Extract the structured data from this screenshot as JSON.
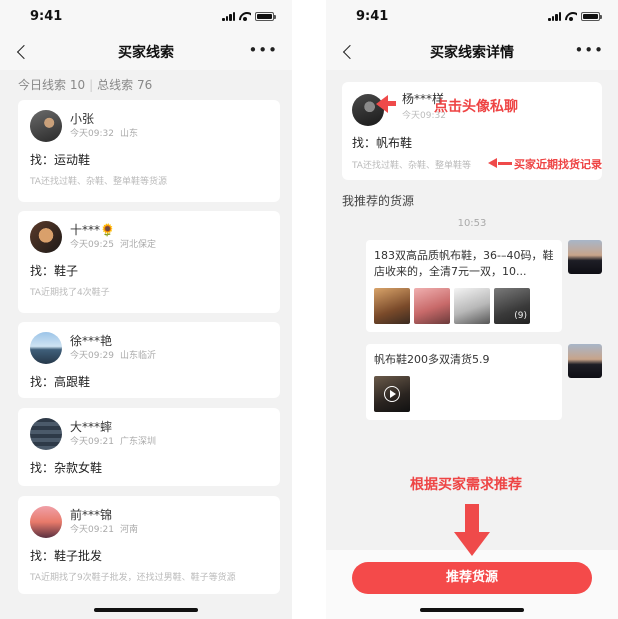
{
  "left_screen": {
    "status_time": "9:41",
    "title": "买家线索",
    "summary_today": "今日线索 10",
    "summary_total": "总线索 76",
    "leads": [
      {
        "name": "小张",
        "time": "今天09:32",
        "location": "山东",
        "want": "找：运动鞋",
        "history": "TA还找过鞋、杂鞋、整单鞋等货源"
      },
      {
        "name": "十***🌻",
        "time": "今天09:25",
        "location": "河北保定",
        "want": "找：鞋子",
        "history": "TA近期找了4次鞋子"
      },
      {
        "name": "徐***艳",
        "time": "今天09:29",
        "location": "山东临沂",
        "want": "找：高跟鞋",
        "history": ""
      },
      {
        "name": "大***蟀",
        "time": "今天09:21",
        "location": "广东深圳",
        "want": "找：杂款女鞋",
        "history": ""
      },
      {
        "name": "前***锦",
        "time": "今天09:21",
        "location": "河南",
        "want": "找：鞋子批发",
        "history": "TA近期找了9次鞋子批发，还找过男鞋、鞋子等货源"
      }
    ]
  },
  "right_screen": {
    "status_time": "9:41",
    "title": "买家线索详情",
    "buyer": {
      "name": "杨***样",
      "sub": "今天09:32",
      "want": "找：帆布鞋",
      "history": "TA还找过鞋、杂鞋、整单鞋等"
    },
    "section_title": "我推荐的货源",
    "timestamp": "10:53",
    "messages": [
      {
        "text": "183双高品质帆布鞋，36-–40码，鞋店收来的，全清7元一双，10...",
        "thumb_count": "(9)"
      },
      {
        "text": "帆布鞋200多双清货5.9"
      }
    ],
    "button_label": "推荐货源"
  },
  "annotations": {
    "avatar_chat": "点击头像私聊",
    "recent_history": "买家近期找货记录",
    "recommend_by_need": "根据买家需求推荐"
  },
  "colors": {
    "accent_red": "#f44a4a",
    "annotation_red": "#ee4444",
    "background": "#f2f2f2"
  }
}
